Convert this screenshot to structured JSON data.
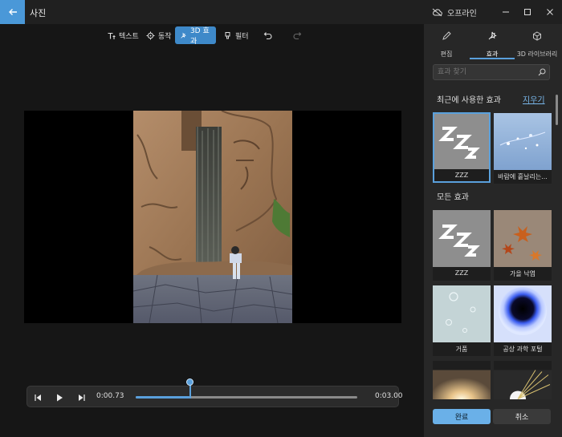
{
  "window": {
    "title": "사진",
    "offline_label": "오프라인"
  },
  "toolbar": {
    "text_label": "텍스트",
    "motion_label": "동작",
    "effects3d_label": "3D 효과",
    "filter_label": "필터"
  },
  "timeline": {
    "current_time": "0:00.73",
    "end_time": "0:03.00",
    "progress": 0.243
  },
  "panel": {
    "tabs": [
      {
        "label": "편집",
        "icon": "pencil-icon"
      },
      {
        "label": "효과",
        "icon": "effects-icon",
        "active": true
      },
      {
        "label": "3D 라이브러리",
        "icon": "cube-icon"
      }
    ],
    "search_placeholder": "효과 찾기",
    "recent_title": "최근에 사용한 효과",
    "clear_label": "지우기",
    "recent_effects": [
      {
        "label": "ZZZ",
        "selected": true
      },
      {
        "label": "바람에 흩날리는..."
      }
    ],
    "all_title": "모든 효과",
    "all_effects": [
      {
        "label": "ZZZ"
      },
      {
        "label": "가을 낙엽"
      },
      {
        "label": "거품"
      },
      {
        "label": "공상 과학 포털"
      },
      {
        "label": ""
      },
      {
        "label": ""
      }
    ],
    "done_label": "완료",
    "cancel_label": "취소"
  }
}
